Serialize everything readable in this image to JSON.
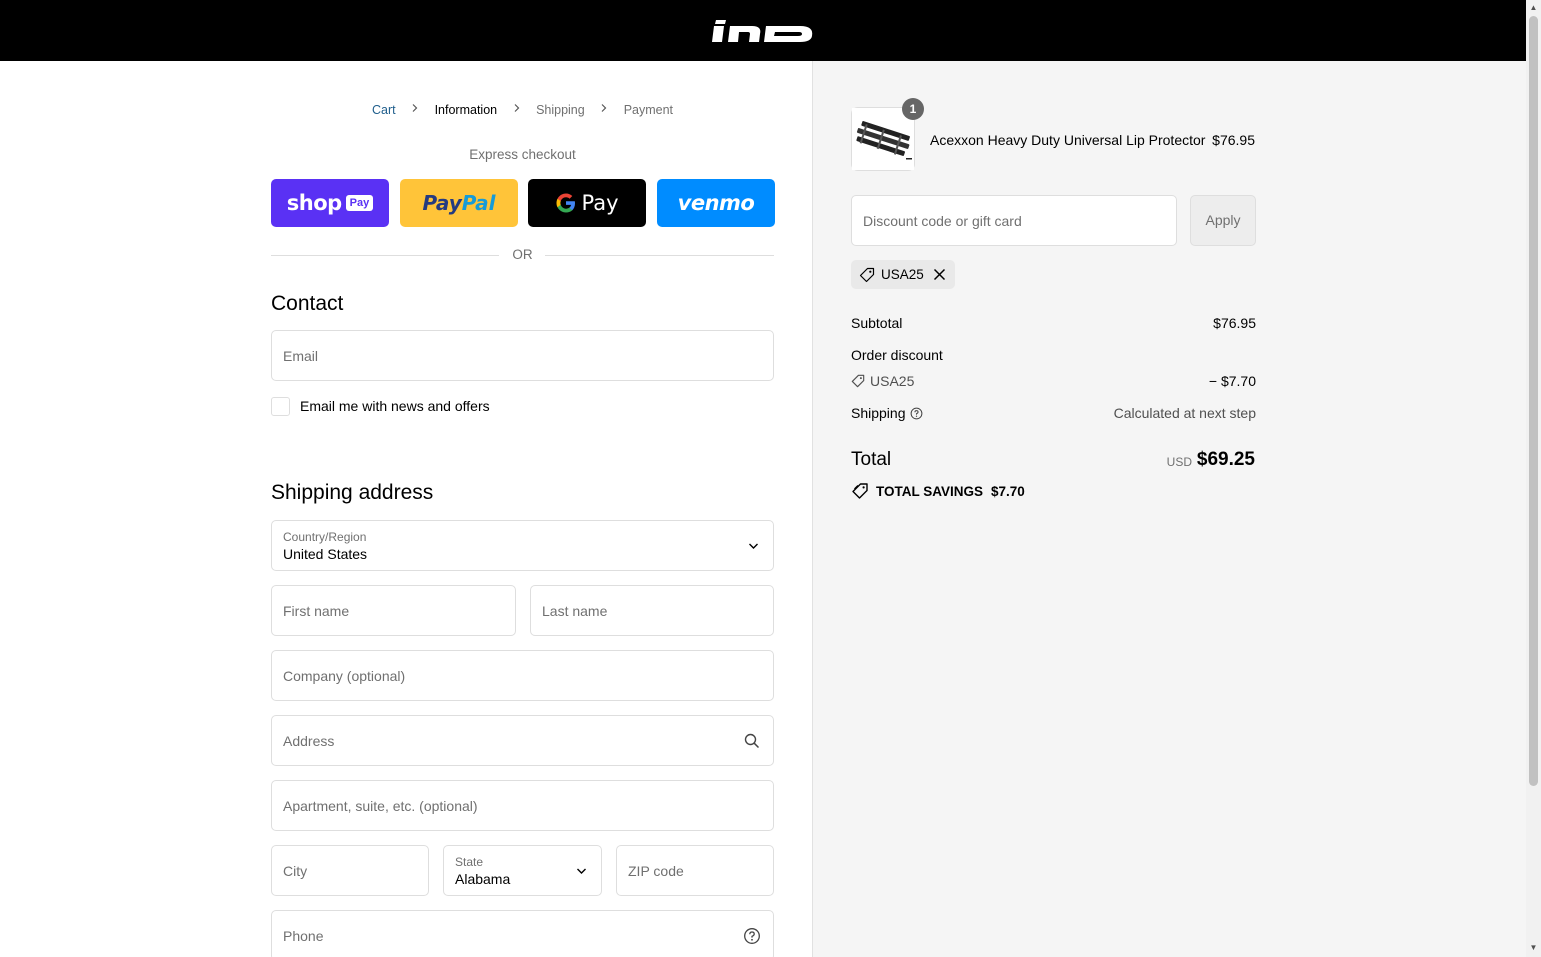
{
  "header": {
    "logo_text": "IND",
    "logo_icon": "brand-logo"
  },
  "breadcrumb": {
    "items": [
      "Cart",
      "Information",
      "Shipping",
      "Payment"
    ]
  },
  "express": {
    "label": "Express checkout",
    "shop_pay": {
      "word": "shop",
      "badge": "Pay",
      "color": "#5a31f4"
    },
    "paypal": {
      "pay": "Pay",
      "pal": "Pal",
      "color": "#ffc439"
    },
    "gpay": {
      "g": "G",
      "pay": "Pay",
      "color": "#000000"
    },
    "venmo": {
      "word": "venmo",
      "color": "#008cff"
    },
    "or": "OR"
  },
  "contact": {
    "title": "Contact",
    "email_placeholder": "Email",
    "newsletter_label": "Email me with news and offers"
  },
  "shipping_address": {
    "title": "Shipping address",
    "country_label": "Country/Region",
    "country_value": "United States",
    "first_name": "First name",
    "last_name": "Last name",
    "company": "Company (optional)",
    "address": "Address",
    "apartment": "Apartment, suite, etc. (optional)",
    "city": "City",
    "state_label": "State",
    "state_value": "Alabama",
    "zip": "ZIP code",
    "phone": "Phone"
  },
  "summary": {
    "product": {
      "name": "Acexxon Heavy Duty Universal Lip Protector",
      "price": "$76.95",
      "quantity": "1"
    },
    "discount_placeholder": "Discount code or gift card",
    "apply_label": "Apply",
    "applied_code": "USA25",
    "subtotal_label": "Subtotal",
    "subtotal_value": "$76.95",
    "order_discount_label": "Order discount",
    "discount_code": "USA25",
    "discount_value": "− $7.70",
    "shipping_label": "Shipping",
    "shipping_value": "Calculated at next step",
    "total_label": "Total",
    "total_currency": "USD",
    "total_value": "$69.25",
    "savings_label": "TOTAL SAVINGS",
    "savings_value": "$7.70"
  }
}
